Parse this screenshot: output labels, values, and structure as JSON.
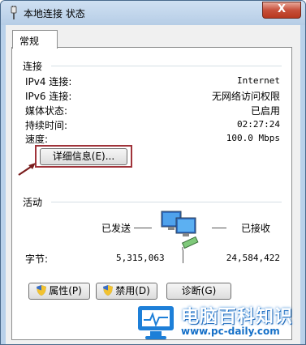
{
  "window": {
    "title": "本地连接 状态",
    "close_glyph": "X"
  },
  "tabs": [
    {
      "label": "常规"
    }
  ],
  "connection": {
    "group_label": "连接",
    "rows": [
      {
        "label": "IPv4 连接:",
        "value": "Internet"
      },
      {
        "label": "IPv6 连接:",
        "value": "无网络访问权限"
      },
      {
        "label": "媒体状态:",
        "value": "已启用"
      },
      {
        "label": "持续时间:",
        "value": "02:27:24"
      },
      {
        "label": "速度:",
        "value": "100.0 Mbps"
      }
    ],
    "details_button": "详细信息(E)..."
  },
  "activity": {
    "group_label": "活动",
    "sent_label": "已发送",
    "received_label": "已接收",
    "bytes_label": "字节:",
    "bytes_sent": "5,315,063",
    "bytes_received": "24,584,422"
  },
  "buttons": {
    "properties": "属性(P)",
    "disable": "禁用(D)",
    "diagnose": "诊断(G)"
  },
  "watermark": {
    "title": "电脑百科知识",
    "url": "www.pc-daily.com"
  },
  "icons": {
    "title": "network-plug-icon",
    "activity": "network-computers-icon",
    "shield": "uac-shield-icon"
  }
}
